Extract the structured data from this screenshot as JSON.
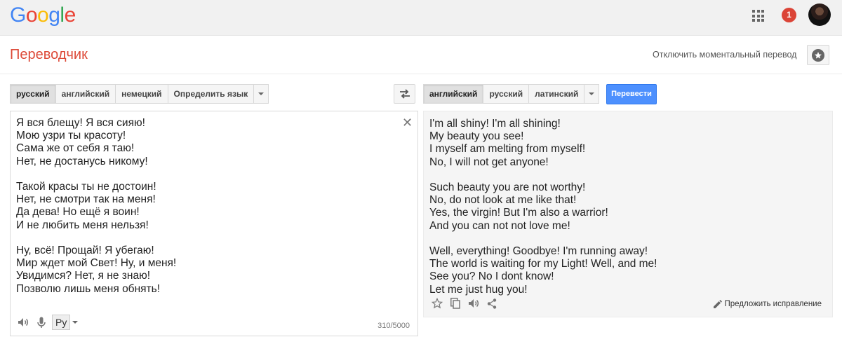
{
  "header": {
    "logo_letters": [
      {
        "ch": "G",
        "color": "#4285f4"
      },
      {
        "ch": "o",
        "color": "#ea4335"
      },
      {
        "ch": "o",
        "color": "#fbbc05"
      },
      {
        "ch": "g",
        "color": "#4285f4"
      },
      {
        "ch": "l",
        "color": "#34a853"
      },
      {
        "ch": "e",
        "color": "#ea4335"
      }
    ],
    "notification_count": "1"
  },
  "subheader": {
    "title": "Переводчик",
    "instant_toggle_label": "Отключить моментальный перевод"
  },
  "source": {
    "languages": [
      "русский",
      "английский",
      "немецкий",
      "Определить язык"
    ],
    "selected_index": 0,
    "text": "Я вся блещу! Я вся сияю!\nМою узри ты красоту!\nСама же от себя я таю!\nНет, не достанусь никому!\n\nТакой красы ты не достоин!\nНет, не смотри так на меня!\nДа дева! Но ещё я воин!\nИ не любить меня нельзя!\n\nНу, всё! Прощай! Я убегаю!\nМир ждет мой Свет! Ну, и меня!\nУвидимся? Нет, я не знаю!\nПозволю лишь меня обнять!",
    "input_method_label": "Ру",
    "char_count": "310/5000"
  },
  "target": {
    "languages": [
      "английский",
      "русский",
      "латинский"
    ],
    "selected_index": 0,
    "translate_button": "Перевести",
    "text": "I'm all shiny! I'm all shining!\nMy beauty you see!\nI myself am melting from myself!\nNo, I will not get anyone!\n\nSuch beauty you are not worthy!\nNo, do not look at me like that!\nYes, the virgin! But I'm also a warrior!\nAnd you can not not love me!\n\nWell, everything! Goodbye! I'm running away!\nThe world is waiting for my Light! Well, and me!\nSee you? No I dont know!\nLet me just hug you!",
    "suggest_edit_label": "Предложить исправление"
  },
  "colors": {
    "accent_red": "#dd4b39",
    "button_blue": "#4d90fe"
  }
}
